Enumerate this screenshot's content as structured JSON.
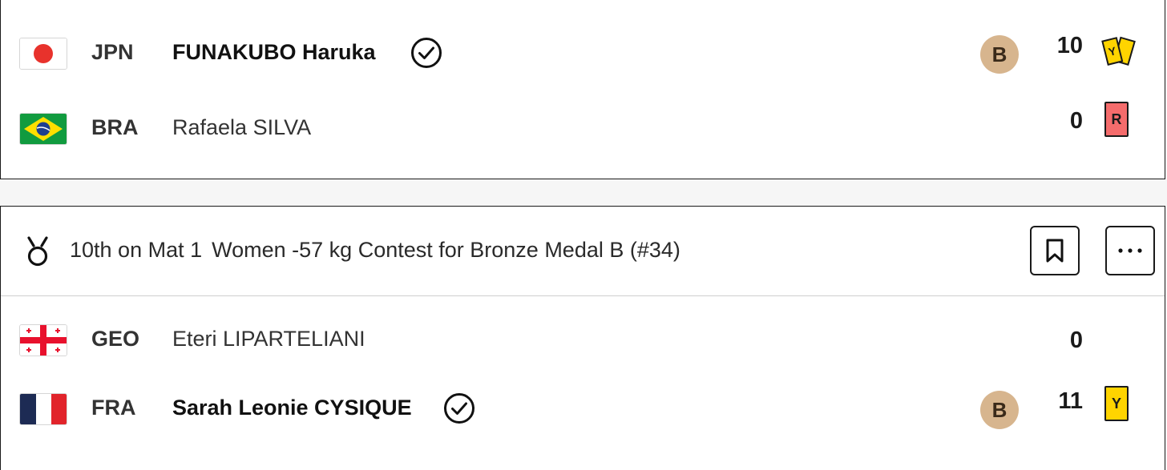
{
  "top_match": {
    "competitors": [
      {
        "noc": "JPN",
        "name": "FUNAKUBO Haruka",
        "winner": true,
        "medal": "B",
        "score": "10",
        "penalty": "Y"
      },
      {
        "noc": "BRA",
        "name": "Rafaela SILVA",
        "winner": false,
        "score": "0",
        "penalty": "R"
      }
    ]
  },
  "bottom_match": {
    "order": "10th on Mat 1",
    "description": "Women -57 kg Contest for Bronze Medal B (#34)",
    "competitors": [
      {
        "noc": "GEO",
        "name": "Eteri LIPARTELIANI",
        "winner": false,
        "score": "0"
      },
      {
        "noc": "FRA",
        "name": "Sarah Leonie CYSIQUE",
        "winner": true,
        "medal": "B",
        "score": "11",
        "penalty": "Y"
      }
    ]
  },
  "colors": {
    "bronze": "#d7b58e",
    "yellow_card": "#ffd400",
    "red_card": "#f56c6c"
  },
  "icons": {
    "winner": "check-circle-icon",
    "medal": "medal-icon",
    "bookmark": "bookmark-icon",
    "more": "more-horizontal-icon"
  }
}
